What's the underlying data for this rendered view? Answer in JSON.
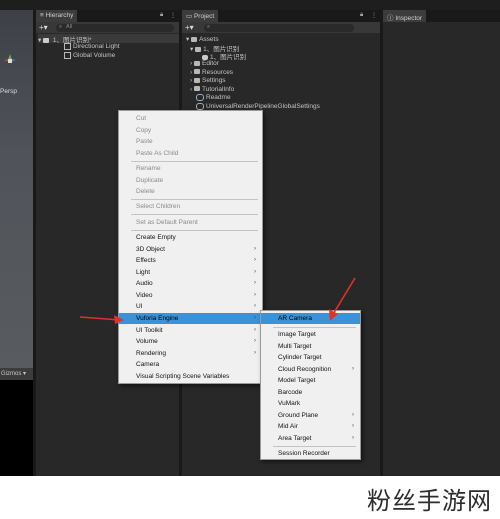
{
  "scene": {
    "persp_label": "Persp",
    "gizmos_label": "Gizmos"
  },
  "hierarchy": {
    "tab": "Hierarchy",
    "search_placeholder": "All",
    "scene_name": "1、图片识别*",
    "items": [
      "Directional Light",
      "Global Volume"
    ]
  },
  "project": {
    "tab": "Project",
    "root": "Assets",
    "items": [
      {
        "label": "1、图片识别",
        "kind": "folder"
      },
      {
        "label": "1、图片识别",
        "kind": "scene"
      },
      {
        "label": "Editor",
        "kind": "folder"
      },
      {
        "label": "Resources",
        "kind": "folder"
      },
      {
        "label": "Settings",
        "kind": "folder"
      },
      {
        "label": "TutorialInfo",
        "kind": "folder"
      },
      {
        "label": "Readme",
        "kind": "asset"
      },
      {
        "label": "UniversalRenderPipelineGlobalSettings",
        "kind": "asset"
      }
    ]
  },
  "inspector": {
    "tab": "Inspector"
  },
  "context_menu": {
    "items": [
      {
        "label": "Cut"
      },
      {
        "label": "Copy"
      },
      {
        "label": "Paste"
      },
      {
        "label": "Paste As Child"
      },
      {
        "label": "Rename"
      },
      {
        "label": "Duplicate"
      },
      {
        "label": "Delete"
      },
      {
        "label": "Select Children"
      },
      {
        "label": "Set as Default Parent"
      },
      {
        "label": "Create Empty"
      },
      {
        "label": "3D Object"
      },
      {
        "label": "Effects"
      },
      {
        "label": "Light"
      },
      {
        "label": "Audio"
      },
      {
        "label": "Video"
      },
      {
        "label": "UI"
      },
      {
        "label": "Vuforia Engine"
      },
      {
        "label": "UI Toolkit"
      },
      {
        "label": "Volume"
      },
      {
        "label": "Rendering"
      },
      {
        "label": "Camera"
      },
      {
        "label": "Visual Scripting Scene Variables"
      }
    ],
    "submenu_arrow": "›"
  },
  "vuforia_submenu": {
    "items": [
      {
        "label": "AR Camera"
      },
      {
        "label": "Image Target"
      },
      {
        "label": "Multi Target"
      },
      {
        "label": "Cylinder Target"
      },
      {
        "label": "Cloud Recognition"
      },
      {
        "label": "Model Target"
      },
      {
        "label": "Barcode"
      },
      {
        "label": "VuMark"
      },
      {
        "label": "Ground Plane"
      },
      {
        "label": "Mid Air"
      },
      {
        "label": "Area Target"
      },
      {
        "label": "Session Recorder"
      }
    ]
  },
  "annotation_color": "#e0312b",
  "highlight_color": "#3b92d6",
  "watermark": "粉丝手游网"
}
